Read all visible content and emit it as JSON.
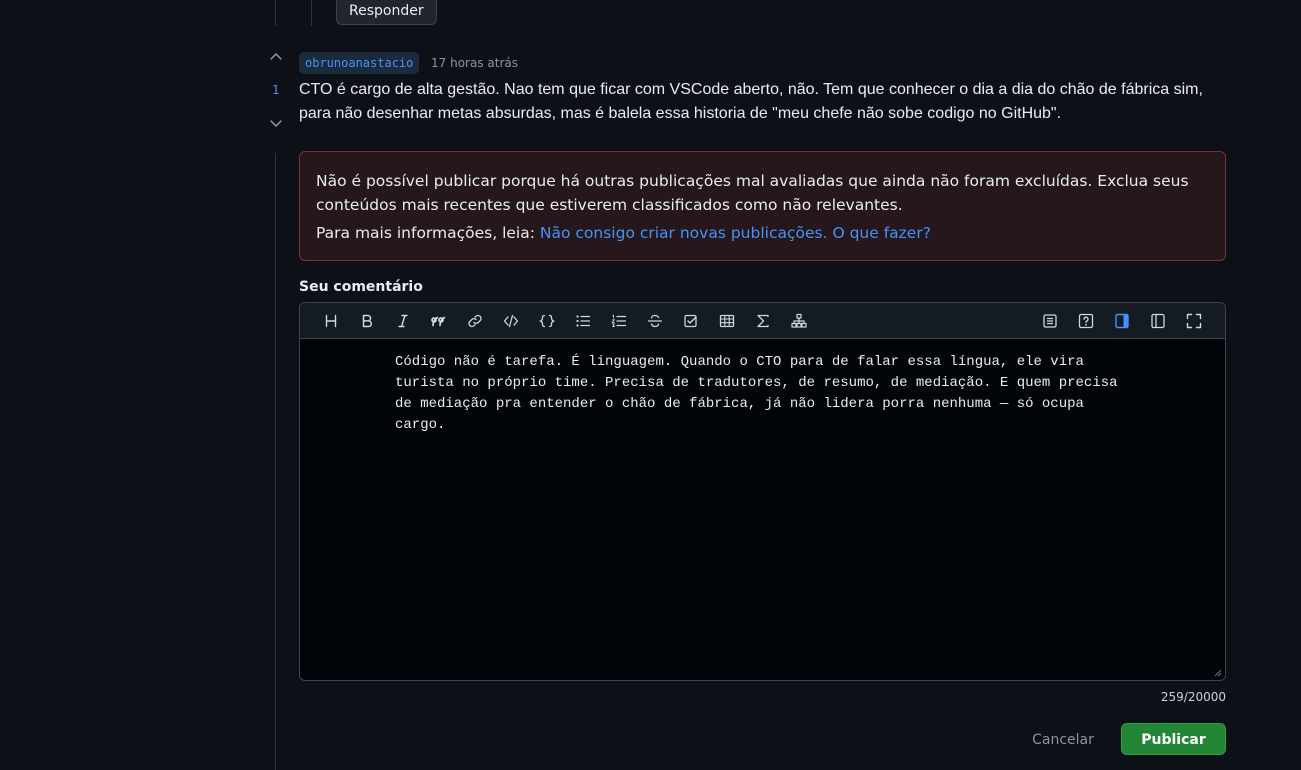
{
  "parent_comment": {
    "reply_label": "Responder"
  },
  "comment": {
    "author": "obrunoanastacio",
    "timestamp": "17 horas atrás",
    "vote_count": "1",
    "body": "CTO é cargo de alta gestão. Nao tem que ficar com VSCode aberto, não. Tem que conhecer o dia a dia do chão de fábrica sim, para não desenhar metas absurdas, mas é balela essa historia de \"meu chefe não sobe codigo no GitHub\"."
  },
  "alert": {
    "message": "Não é possível publicar porque há outras publicações mal avaliadas que ainda não foram excluídas. Exclua seus conteúdos mais recentes que estiverem classificados como não relevantes.",
    "info_prefix": "Para mais informações, leia: ",
    "info_link": "Não consigo criar novas publicações. O que fazer?"
  },
  "editor": {
    "label": "Seu comentário",
    "value": "Código não é tarefa. É linguagem. Quando o CTO para de falar essa língua, ele vira turista no próprio time. Precisa de tradutores, de resumo, de mediação. E quem precisa de mediação pra entender o chão de fábrica, já não lidera porra nenhuma — só ocupa cargo.",
    "char_count": "259/20000",
    "toolbar_left": [
      "heading-icon",
      "bold-icon",
      "italic-icon",
      "quote-icon",
      "link-icon",
      "code-icon",
      "code-block-icon",
      "unordered-list-icon",
      "ordered-list-icon",
      "strikethrough-icon",
      "task-list-icon",
      "table-icon",
      "math-icon",
      "diagram-icon"
    ],
    "toolbar_right": [
      "preview-icon",
      "help-icon",
      "side-by-side-icon",
      "split-view-icon",
      "fullscreen-icon"
    ],
    "active_tool": "side-by-side-icon"
  },
  "actions": {
    "cancel_label": "Cancelar",
    "publish_label": "Publicar"
  },
  "colors": {
    "accent": "#4493f8",
    "publish": "#238636",
    "alert_border": "#7e2f32",
    "background": "#0d1117"
  }
}
